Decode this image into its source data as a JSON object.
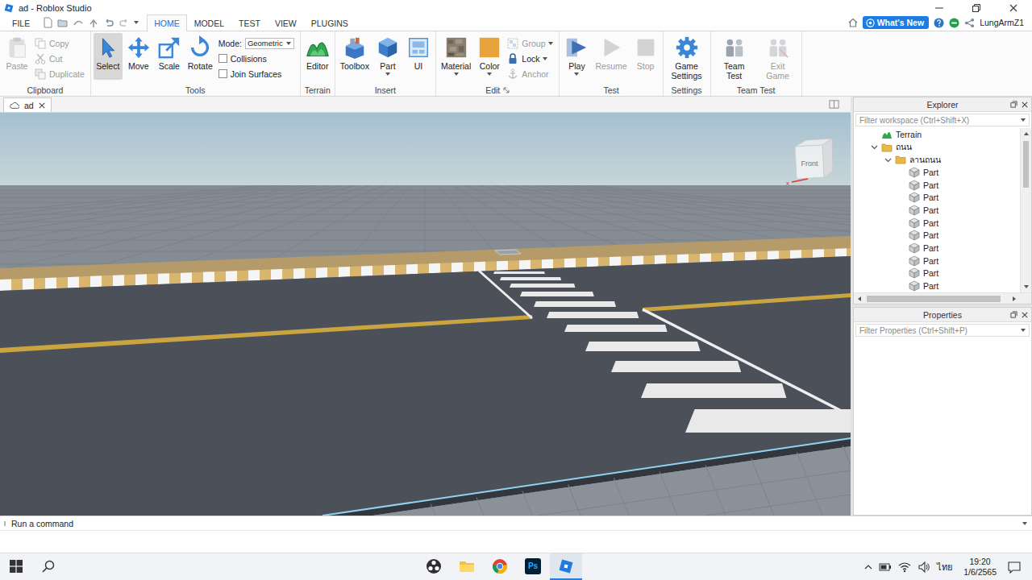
{
  "window": {
    "title": "ad - Roblox Studio"
  },
  "menu_tabs": [
    {
      "label": "FILE",
      "kind": "file",
      "selected": false
    },
    {
      "label": "HOME",
      "kind": "tab",
      "selected": true
    },
    {
      "label": "MODEL",
      "kind": "tab",
      "selected": false
    },
    {
      "label": "TEST",
      "kind": "tab",
      "selected": false
    },
    {
      "label": "VIEW",
      "kind": "tab",
      "selected": false
    },
    {
      "label": "PLUGINS",
      "kind": "tab",
      "selected": false
    }
  ],
  "account": {
    "whats_new": "What's New",
    "user": "LungArmZ1"
  },
  "ribbon": [
    {
      "label": "Clipboard",
      "launcher": false,
      "items": [
        {
          "kind": "large",
          "label": "Paste",
          "disabled": true,
          "selected": false,
          "menu": false
        },
        {
          "kind": "stack",
          "entries": [
            {
              "kind": "button",
              "label": "Copy",
              "disabled": true,
              "menu": false
            },
            {
              "kind": "button",
              "label": "Cut",
              "disabled": true,
              "menu": false
            },
            {
              "kind": "button",
              "label": "Duplicate",
              "disabled": true,
              "menu": false
            }
          ]
        }
      ]
    },
    {
      "label": "Tools",
      "launcher": false,
      "items": [
        {
          "kind": "large",
          "label": "Select",
          "disabled": false,
          "selected": true,
          "menu": false
        },
        {
          "kind": "large",
          "label": "Move",
          "disabled": false,
          "selected": false,
          "menu": false
        },
        {
          "kind": "large",
          "label": "Scale",
          "disabled": false,
          "selected": false,
          "menu": false
        },
        {
          "kind": "large",
          "label": "Rotate",
          "disabled": false,
          "selected": false,
          "menu": false
        },
        {
          "kind": "stack",
          "entries": [
            {
              "kind": "dropdown",
              "label": "Mode:",
              "value": "Geometric"
            },
            {
              "kind": "checkbox",
              "label": "Collisions",
              "checked": false
            },
            {
              "kind": "checkbox",
              "label": "Join Surfaces",
              "checked": false
            }
          ]
        }
      ]
    },
    {
      "label": "Terrain",
      "launcher": false,
      "items": [
        {
          "kind": "large",
          "label": "Editor",
          "disabled": false,
          "selected": false,
          "menu": false
        }
      ]
    },
    {
      "label": "Insert",
      "launcher": false,
      "items": [
        {
          "kind": "large",
          "label": "Toolbox",
          "disabled": false,
          "selected": false,
          "menu": false
        },
        {
          "kind": "large",
          "label": "Part",
          "disabled": false,
          "selected": false,
          "menu": true
        },
        {
          "kind": "large",
          "label": "UI",
          "disabled": false,
          "selected": false,
          "menu": false
        }
      ]
    },
    {
      "label": "Edit",
      "launcher": true,
      "items": [
        {
          "kind": "large",
          "label": "Material",
          "disabled": false,
          "selected": false,
          "menu": true
        },
        {
          "kind": "large",
          "label": "Color",
          "disabled": false,
          "selected": false,
          "menu": true
        },
        {
          "kind": "stack",
          "entries": [
            {
              "kind": "button",
              "label": "Group",
              "disabled": true,
              "menu": true
            },
            {
              "kind": "button",
              "label": "Lock",
              "disabled": false,
              "menu": true
            },
            {
              "kind": "button",
              "label": "Anchor",
              "disabled": true,
              "menu": false
            }
          ]
        }
      ]
    },
    {
      "label": "Test",
      "launcher": false,
      "items": [
        {
          "kind": "large",
          "label": "Play",
          "disabled": false,
          "selected": false,
          "menu": true
        },
        {
          "kind": "large",
          "label": "Resume",
          "disabled": true,
          "selected": false,
          "menu": false
        },
        {
          "kind": "large",
          "label": "Stop",
          "disabled": true,
          "selected": false,
          "menu": false
        }
      ]
    },
    {
      "label": "Settings",
      "launcher": false,
      "items": [
        {
          "kind": "large",
          "label": "Game Settings",
          "disabled": false,
          "selected": false,
          "menu": false
        }
      ]
    },
    {
      "label": "Team Test",
      "launcher": false,
      "items": [
        {
          "kind": "large",
          "label": "Team Test",
          "disabled": false,
          "selected": false,
          "menu": false
        },
        {
          "kind": "large",
          "label": "Exit Game",
          "disabled": true,
          "selected": false,
          "menu": false
        }
      ]
    }
  ],
  "document_tab": {
    "label": "ad",
    "selected": true
  },
  "viewport": {
    "view_cube": "Front",
    "axis_label": "x"
  },
  "explorer": {
    "title": "Explorer",
    "filter": "Filter workspace (Ctrl+Shift+X)",
    "tree": [
      {
        "label": "Terrain",
        "kind": "terrain"
      },
      {
        "label": "ถนน",
        "kind": "folder",
        "expanded": true,
        "children": [
          {
            "label": "ลานถนน",
            "kind": "folder",
            "expanded": true,
            "children": [
              {
                "label": "Part",
                "kind": "part"
              },
              {
                "label": "Part",
                "kind": "part"
              },
              {
                "label": "Part",
                "kind": "part"
              },
              {
                "label": "Part",
                "kind": "part"
              },
              {
                "label": "Part",
                "kind": "part"
              },
              {
                "label": "Part",
                "kind": "part"
              },
              {
                "label": "Part",
                "kind": "part"
              },
              {
                "label": "Part",
                "kind": "part"
              },
              {
                "label": "Part",
                "kind": "part"
              },
              {
                "label": "Part",
                "kind": "part"
              }
            ]
          }
        ]
      }
    ]
  },
  "properties": {
    "title": "Properties",
    "filter": "Filter Properties (Ctrl+Shift+P)"
  },
  "command_bar": {
    "placeholder": "Run a command"
  },
  "taskbar": {
    "apps": [
      {
        "kind": "obs",
        "selected": false
      },
      {
        "kind": "files",
        "selected": false
      },
      {
        "kind": "chrome",
        "selected": false
      },
      {
        "kind": "photoshop",
        "label": "Ps",
        "selected": false
      },
      {
        "kind": "studio",
        "selected": true
      }
    ],
    "language": "ไทย",
    "time": "19:20",
    "date": "1/6/2565"
  }
}
